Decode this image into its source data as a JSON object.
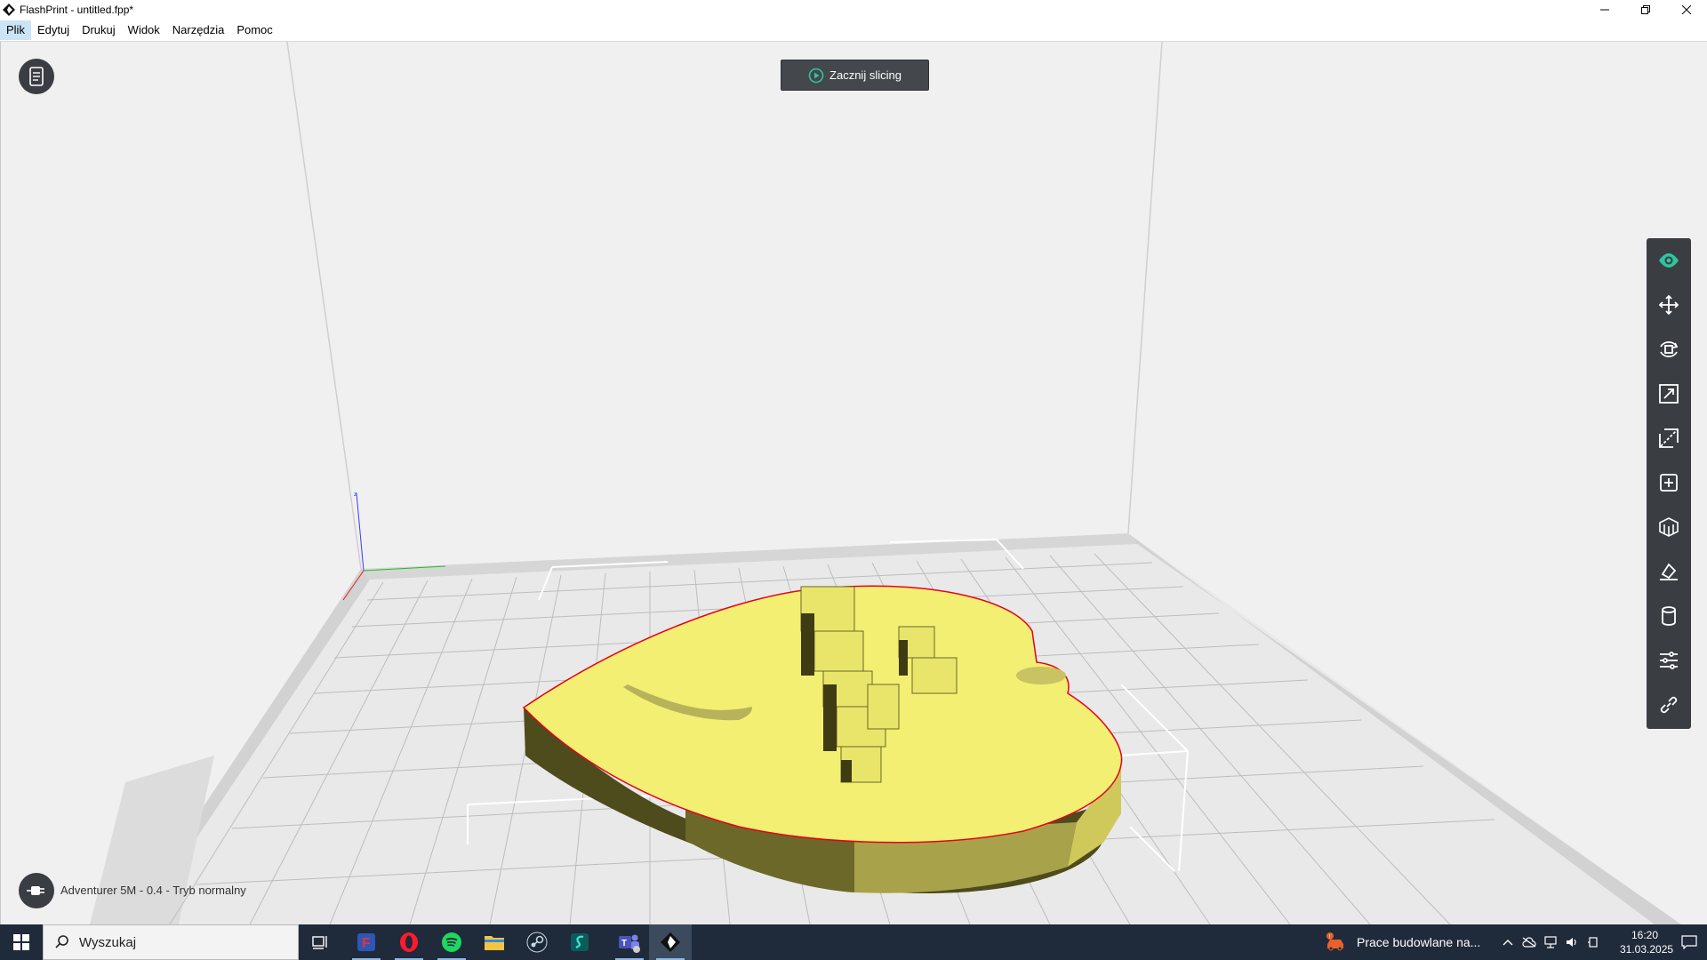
{
  "window": {
    "title": "FlashPrint - untitled.fpp*"
  },
  "menu": {
    "items": [
      "Plik",
      "Edytuj",
      "Drukuj",
      "Widok",
      "Narzędzia",
      "Pomoc"
    ]
  },
  "viewport": {
    "slice_button": "Zacznij slicing",
    "axis_z_label": "z"
  },
  "toolbar": {
    "tools": [
      "eye-icon",
      "move-icon",
      "rotate-icon",
      "scale-icon",
      "cut-icon",
      "add-model-icon",
      "support-icon",
      "bed-level-icon",
      "cylinder-icon",
      "settings-sliders-icon",
      "link-icon"
    ],
    "accent": "#2ec4a0"
  },
  "status": {
    "printer_label": "Adventurer 5M - 0.4 - Tryb normalny"
  },
  "model": {
    "color": "#f2ef72",
    "outline": "#e8001a"
  },
  "taskbar": {
    "search_placeholder": "Wyszukaj",
    "news_text": "Prace budowlane na...",
    "time": "16:20",
    "date": "31.03.2025"
  }
}
